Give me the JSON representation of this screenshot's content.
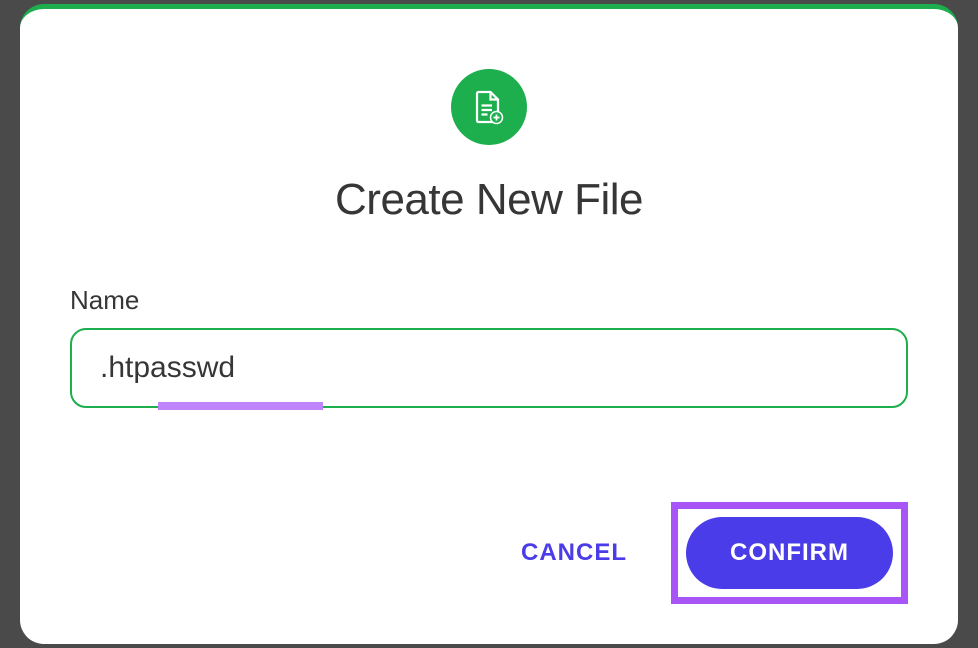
{
  "modal": {
    "title": "Create New File",
    "icon": "file-add-icon"
  },
  "form": {
    "name_label": "Name",
    "name_value": ".htpasswd"
  },
  "buttons": {
    "cancel_label": "CANCEL",
    "confirm_label": "CONFIRM"
  },
  "colors": {
    "accent_green": "#1dae4e",
    "accent_blue": "#4a3ce8",
    "highlight_purple": "#a855f7"
  }
}
